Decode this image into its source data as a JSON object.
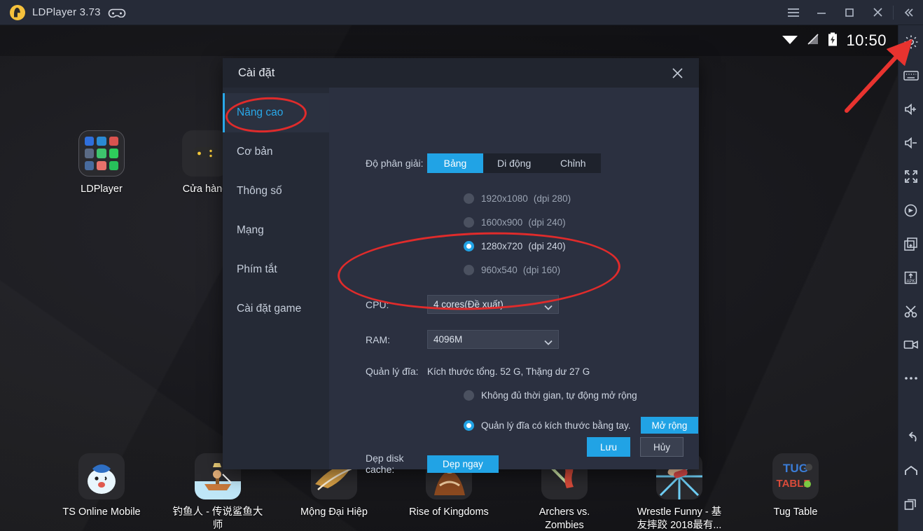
{
  "titlebar": {
    "app_name": "LDPlayer 3.73",
    "logo_icon": "ldplayer-logo-icon",
    "gamepad_icon": "gamepad-icon",
    "menu_label": "menu-icon",
    "minimize_label": "minimize-icon",
    "maximize_label": "maximize-icon",
    "close_label": "close-icon",
    "collapse_label": "collapse-icon"
  },
  "statusbar": {
    "wifi_icon": "wifi-icon",
    "signal_icon": "signal-off-icon",
    "battery_icon": "battery-charging-icon",
    "time": "10:50"
  },
  "desktop": {
    "icons": [
      {
        "label": "LDPlayer",
        "icon": "ldplayer-folder-icon"
      },
      {
        "label": "Cửa hàng",
        "icon": "store-icon"
      },
      {
        "label": "TS Online Mobile",
        "icon": "ts-online-mobile-icon"
      },
      {
        "label": "钓鱼人 - 传说鲨鱼大师",
        "icon": "fishing-game-icon"
      },
      {
        "label": "Mộng Đại Hiệp",
        "icon": "mong-dai-hiep-icon"
      },
      {
        "label": "Rise of Kingdoms",
        "icon": "rise-of-kingdoms-icon"
      },
      {
        "label": "Archers vs. Zombies",
        "icon": "archers-vs-zombies-icon"
      },
      {
        "label": "Wrestle Funny - 基友摔跤 2018最有...",
        "icon": "wrestle-funny-icon"
      },
      {
        "label": "Tug Table",
        "icon": "tug-table-icon"
      }
    ]
  },
  "toolbar": {
    "items": [
      {
        "name": "settings-gear-icon"
      },
      {
        "name": "keyboard-icon"
      },
      {
        "name": "volume-up-icon"
      },
      {
        "name": "volume-down-icon"
      },
      {
        "name": "fullscreen-icon"
      },
      {
        "name": "rotate-screen-icon"
      },
      {
        "name": "multi-instance-icon"
      },
      {
        "name": "install-apk-icon"
      },
      {
        "name": "screenshot-scissors-icon"
      },
      {
        "name": "record-video-icon"
      },
      {
        "name": "more-options-icon"
      }
    ],
    "nav": [
      {
        "name": "back-icon"
      },
      {
        "name": "home-icon"
      },
      {
        "name": "recent-apps-icon"
      }
    ]
  },
  "dialog": {
    "title": "Cài đặt",
    "close_icon": "close-icon",
    "sidebar": [
      {
        "label": "Nâng cao",
        "active": true
      },
      {
        "label": "Cơ bản",
        "active": false
      },
      {
        "label": "Thông số",
        "active": false
      },
      {
        "label": "Mạng",
        "active": false
      },
      {
        "label": "Phím tắt",
        "active": false
      },
      {
        "label": "Cài đặt game",
        "active": false
      }
    ],
    "resolution": {
      "label": "Độ phân giải:",
      "tabs": [
        {
          "label": "Bảng",
          "selected": true
        },
        {
          "label": "Di động",
          "selected": false
        },
        {
          "label": "Chỉnh",
          "selected": false
        }
      ],
      "options": [
        {
          "label": "1920x1080",
          "dpi": "(dpi 280)",
          "selected": false
        },
        {
          "label": "1600x900",
          "dpi": "(dpi 240)",
          "selected": false
        },
        {
          "label": "1280x720",
          "dpi": "(dpi 240)",
          "selected": true
        },
        {
          "label": "960x540",
          "dpi": "(dpi 160)",
          "selected": false
        }
      ]
    },
    "cpu": {
      "label": "CPU:",
      "value": "4 cores(Đề xuất)"
    },
    "ram": {
      "label": "RAM:",
      "value": "4096M"
    },
    "disk": {
      "label": "Quản lý đĩa:",
      "summary": "Kích thước tổng. 52 G,  Thặng dư 27 G",
      "auto_option": "Không đủ thời gian, tự động mở rộng",
      "manual_option": "Quản lý đĩa có kích thước bằng tay.",
      "expand_button": "Mở rộng"
    },
    "cache": {
      "label": "Dẹp disk cache:",
      "button": "Dẹp ngay"
    },
    "actions": {
      "save": "Lưu",
      "cancel": "Hủy"
    }
  },
  "annotations": {
    "color": "#e02b2b",
    "items": [
      "ellipse-around-nang-cao",
      "ellipse-around-cpu-ram",
      "arrow-to-settings-gear"
    ]
  }
}
